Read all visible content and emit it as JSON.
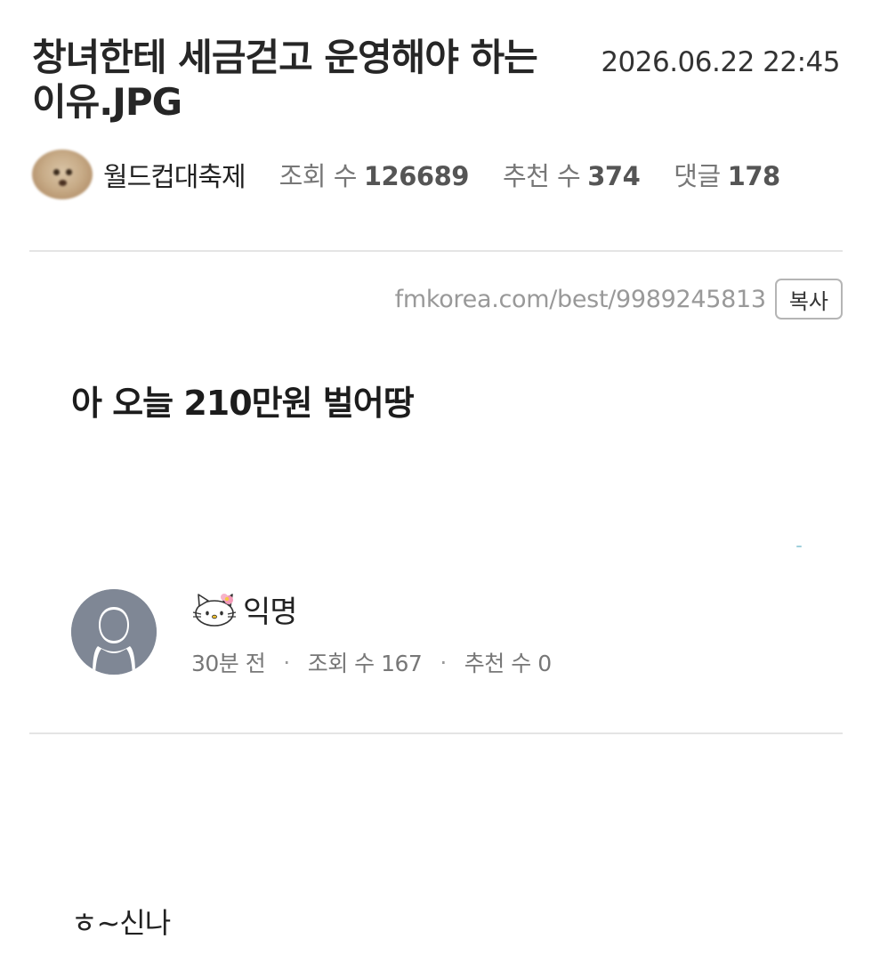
{
  "post": {
    "title": "창녀한테 세금걷고 운영해야 하는 이유.JPG",
    "date": "2026.06.22 22:45",
    "author": "월드컵대축제",
    "views_label": "조회 수",
    "views": "126689",
    "recommend_label": "추천 수",
    "recommend": "374",
    "comments_label": "댓글",
    "comments": "178",
    "url": "fmkorea.com/best/9989245813",
    "copy_label": "복사"
  },
  "content": {
    "heading": "아 오늘 210만원 벌어땅",
    "comment": {
      "author": "익명",
      "time": "30분 전",
      "views": "조회 수 167",
      "recommend": "추천 수 0",
      "separator": "·",
      "text": "ㅎ~신나"
    }
  },
  "icons": {
    "author_avatar": "puppy-avatar-icon",
    "comment_avatar": "default-user-avatar-icon",
    "author_badge": "hello-kitty-icon"
  },
  "colors": {
    "divider": "#e4e4e4",
    "muted_text": "#777777",
    "avatar_bg": "#7f8795"
  }
}
